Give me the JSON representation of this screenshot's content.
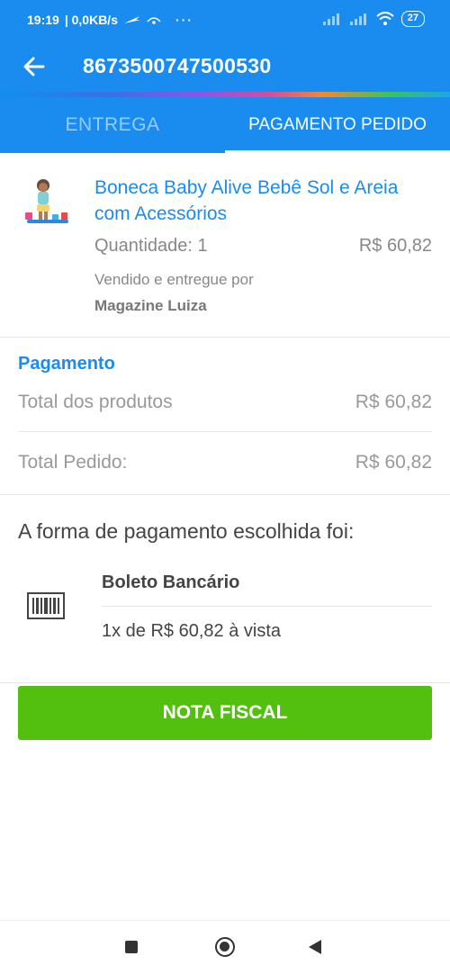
{
  "status_bar": {
    "time": "19:19",
    "network": "| 0,0KB/s",
    "dots": "···",
    "battery": "27"
  },
  "app_bar": {
    "order_number": "8673500747500530"
  },
  "tabs": [
    {
      "label": "ENTREGA"
    },
    {
      "label": "PAGAMENTO PEDIDO"
    }
  ],
  "product": {
    "name": "Boneca Baby Alive Bebê Sol e Areia com Acessórios",
    "quantity": "Quantidade: 1",
    "price": "R$ 60,82",
    "sold_by_label": "Vendido e entregue por",
    "seller": "Magazine Luiza"
  },
  "payment": {
    "title": "Pagamento",
    "total_products_label": "Total dos produtos",
    "total_products_value": "R$ 60,82",
    "total_order_label": "Total Pedido:",
    "total_order_value": "R$ 60,82",
    "chosen_label": "A forma de pagamento escolhida foi:",
    "method": "Boleto Bancário",
    "installments": "1x de R$ 60,82 à vista"
  },
  "actions": {
    "nota_fiscal": "NOTA FISCAL"
  },
  "colors": {
    "primary": "#1a8cf0",
    "button_green": "#53c010"
  }
}
